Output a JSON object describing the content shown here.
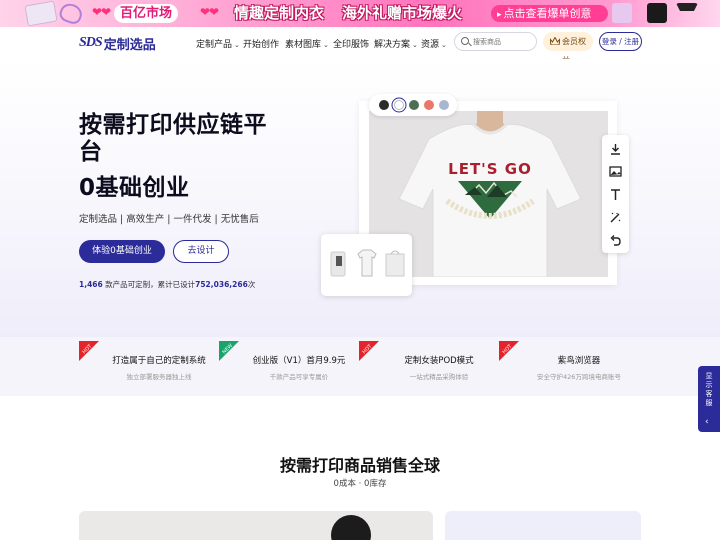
{
  "promo": {
    "left_tag": "百亿市场",
    "headline1": "情趣定制内衣",
    "headline2": "海外礼赠市场爆火",
    "cta": "点击查看爆单创意",
    "hearts": "❤❤"
  },
  "nav": {
    "logo_mark": "SDS",
    "logo_text": "定制选品",
    "items": [
      {
        "label": "定制产品",
        "has_dropdown": true
      },
      {
        "label": "开始创作",
        "has_dropdown": false
      },
      {
        "label": "素材图库",
        "has_dropdown": true
      },
      {
        "label": "全印服饰",
        "has_dropdown": false
      },
      {
        "label": "解决方案",
        "has_dropdown": true
      },
      {
        "label": "资源",
        "has_dropdown": true
      }
    ],
    "search_placeholder": "搜索商品",
    "vip_label": "会员权益",
    "login_label": "登录 / 注册"
  },
  "hero": {
    "title_line1": "按需打印供应链平台",
    "title_line2": "0基础创业",
    "subtitle": "定制选品 | 高效生产 | 一件代发 | 无忧售后",
    "primary_button": "体验0基础创业",
    "secondary_button": "去设计",
    "stats": {
      "products_count": "1,466",
      "products_text": " 款产品可定制，累计已设计",
      "designs_count": "752,036,266",
      "designs_suffix": "次"
    },
    "swatch_colors": [
      "#2b2b2b",
      "#ffffff",
      "#4f6f55",
      "#e9786a",
      "#a8b7cf"
    ],
    "selected_swatch": 1,
    "shirt_print": "LET'S GO",
    "tools": [
      "download-icon",
      "image-icon",
      "text-icon",
      "magic-wand-icon",
      "undo-icon"
    ]
  },
  "features": [
    {
      "badge": "HOT",
      "badge_color": "#e3242b",
      "title": "打造属于自己的定制系统",
      "desc": "独立部署服务器独上线"
    },
    {
      "badge": "NEW",
      "badge_color": "#1aa36b",
      "title": "创业版（V1）首月9.9元",
      "desc": "千款产品可享专属价"
    },
    {
      "badge": "HOT",
      "badge_color": "#e3242b",
      "title": "定制女装POD模式",
      "desc": "一站式精品采购体验"
    },
    {
      "badge": "HOT",
      "badge_color": "#e3242b",
      "title": "紫鸟浏览器",
      "desc": "安全守护426万跨境电商账号"
    }
  ],
  "side_float": {
    "label": "显示客服"
  },
  "section": {
    "title": "按需打印商品销售全球",
    "subtitle": "0成本 · 0库存"
  }
}
